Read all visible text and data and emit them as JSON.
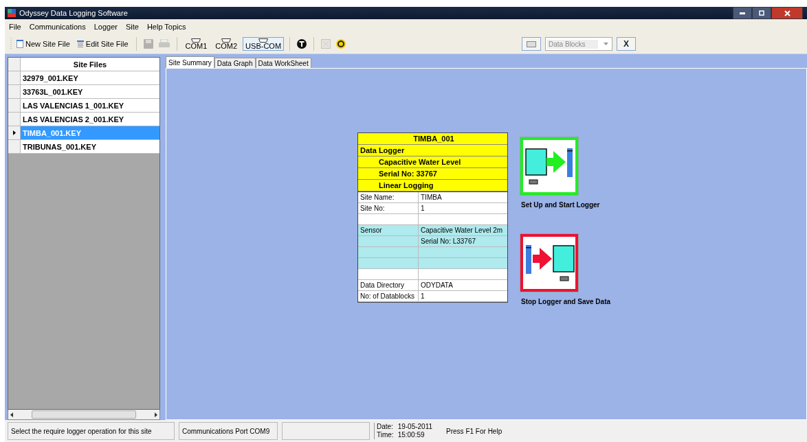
{
  "window": {
    "title": "Odyssey Data Logging Software"
  },
  "menu": [
    "File",
    "Communications",
    "Logger",
    "Site",
    "Help Topics"
  ],
  "toolbar": [
    {
      "kind": "newfile",
      "label": "New Site File"
    },
    {
      "kind": "editfile",
      "label": "Edit Site File"
    },
    {
      "kind": "sep"
    },
    {
      "kind": "save",
      "disabled": true
    },
    {
      "kind": "print",
      "disabled": true
    },
    {
      "kind": "sep"
    },
    {
      "kind": "port",
      "label": "COM1",
      "selected": false
    },
    {
      "kind": "port",
      "label": "COM2",
      "selected": false
    },
    {
      "kind": "port",
      "label": "USB-COM",
      "selected": true
    },
    {
      "kind": "sep"
    },
    {
      "kind": "tool",
      "disabled": false
    },
    {
      "kind": "sep"
    },
    {
      "kind": "grid",
      "disabled": true
    },
    {
      "kind": "help",
      "disabled": false
    }
  ],
  "blocks": {
    "placeholder": "Data Blocks",
    "close": "X"
  },
  "site_files": {
    "header": "Site Files",
    "rows": [
      {
        "name": "32979_001.KEY",
        "selected": false
      },
      {
        "name": "33763L_001.KEY",
        "selected": false
      },
      {
        "name": "LAS VALENCIAS 1_001.KEY",
        "selected": false
      },
      {
        "name": "LAS VALENCIAS 2_001.KEY",
        "selected": false
      },
      {
        "name": "TIMBA_001.KEY",
        "selected": true
      },
      {
        "name": "TRIBUNAS_001.KEY",
        "selected": false
      }
    ]
  },
  "tabs": [
    {
      "label": "Site Summary",
      "selected": true
    },
    {
      "label": "Data Graph",
      "selected": false
    },
    {
      "label": "Data WorkSheet",
      "selected": false
    }
  ],
  "summary": {
    "title": "TIMBA_001",
    "lines": [
      {
        "kind": "heading",
        "text": "Data Logger"
      },
      {
        "kind": "detail",
        "text": "Capacitive Water Level"
      },
      {
        "kind": "detail",
        "text": "Serial No:  33767"
      },
      {
        "kind": "detail",
        "text": "Linear Logging"
      }
    ],
    "rows": [
      {
        "kind": "plain",
        "label": "Site Name:",
        "value": "TIMBA"
      },
      {
        "kind": "plain",
        "label": "Site No:",
        "value": "1"
      },
      {
        "kind": "plain"
      },
      {
        "kind": "sensor",
        "label": "Sensor",
        "value": "Capacitive Water Level  2m"
      },
      {
        "kind": "sensor",
        "value": "Serial No:    L33767"
      },
      {
        "kind": "sensor"
      },
      {
        "kind": "sensor"
      },
      {
        "kind": "plain"
      },
      {
        "kind": "plain",
        "label": "Data Directory",
        "value": "ODYDATA"
      },
      {
        "kind": "plain",
        "label": "No: of Datablocks",
        "value": "1"
      }
    ]
  },
  "actions": [
    {
      "kind": "start",
      "label": "Set Up and Start Logger"
    },
    {
      "kind": "stop",
      "label": "Stop Logger and Save Data"
    }
  ],
  "status_bar": {
    "message": "Select the require logger operation for this site",
    "port": "Communications Port COM9",
    "date_label": "Date:",
    "date": "19-05-2011",
    "time_label": "Time:",
    "time": "15:00:59",
    "help": "Press F1 For Help"
  }
}
